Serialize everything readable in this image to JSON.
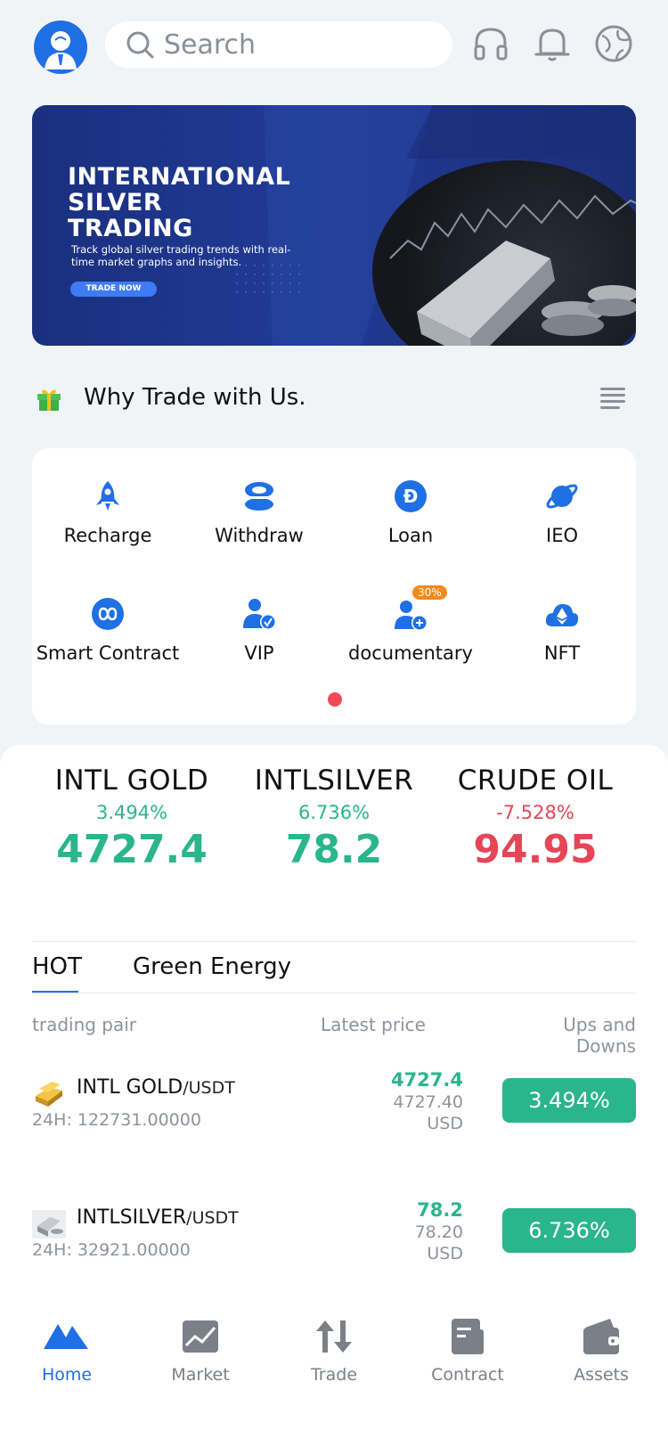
{
  "header": {
    "search_placeholder": "Search",
    "icons": [
      "avatar-icon",
      "headset-icon",
      "bell-icon",
      "globe-icon"
    ]
  },
  "banner": {
    "title_line1": "INTERNATIONAL",
    "title_line2": "SILVER",
    "title_line3": "TRADING",
    "subtitle": "Track global silver trading trends with real-time market graphs and insights.",
    "button": "TRADE NOW"
  },
  "why": {
    "title": "Why Trade with Us."
  },
  "features": [
    {
      "label": "Recharge",
      "icon": "rocket-icon"
    },
    {
      "label": "Withdraw",
      "icon": "coin-stack-icon"
    },
    {
      "label": "Loan",
      "icon": "dogecoin-icon"
    },
    {
      "label": "IEO",
      "icon": "planet-icon"
    },
    {
      "label": "Smart Contract",
      "icon": "infinity-icon"
    },
    {
      "label": "VIP",
      "icon": "vip-user-icon"
    },
    {
      "label": "documentary",
      "icon": "add-user-icon",
      "badge": "30%"
    },
    {
      "label": "NFT",
      "icon": "ethereum-cloud-icon"
    }
  ],
  "tickers": [
    {
      "name": "INTL GOLD",
      "change": "3.494%",
      "price": "4727.4"
    },
    {
      "name": "INTLSILVER",
      "change": "6.736%",
      "price": "78.2"
    },
    {
      "name": "CRUDE OIL",
      "change": "-7.528%",
      "price": "94.95"
    }
  ],
  "tabs": [
    "HOT",
    "Green Energy"
  ],
  "columns": {
    "pair": "trading pair",
    "price": "Latest price",
    "change": "Ups and Downs"
  },
  "rows": [
    {
      "base": "INTL GOLD",
      "quote": "/USDT",
      "vol": "24H: 122731.00000",
      "price": "4727.4",
      "price2": "4727.40",
      "unit": "USD",
      "change": "3.494%"
    },
    {
      "base": "INTLSILVER",
      "quote": "/USDT",
      "vol": "24H: 32921.00000",
      "price": "78.2",
      "price2": "78.20",
      "unit": "USD",
      "change": "6.736%"
    }
  ],
  "tabbar": [
    {
      "label": "Home",
      "icon": "home-icon"
    },
    {
      "label": "Market",
      "icon": "market-chart-icon"
    },
    {
      "label": "Trade",
      "icon": "trade-arrows-icon"
    },
    {
      "label": "Contract",
      "icon": "contract-icon"
    },
    {
      "label": "Assets",
      "icon": "wallet-icon"
    }
  ],
  "colors": {
    "accent": "#1f6fe5",
    "up": "#2bb58c",
    "down": "#e54657"
  }
}
